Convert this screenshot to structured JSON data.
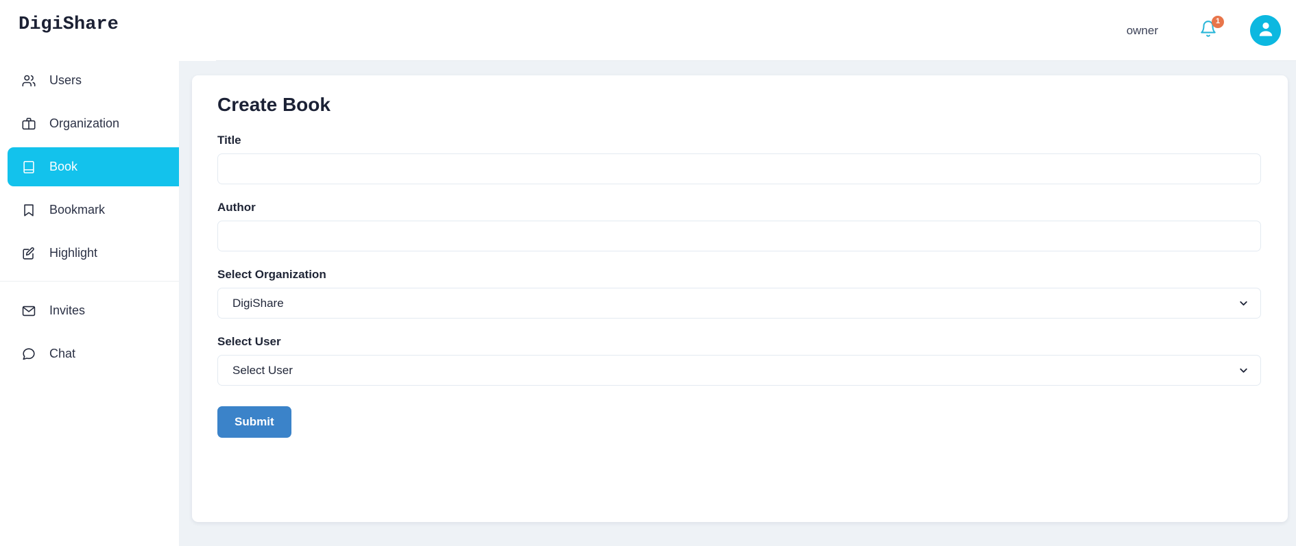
{
  "header": {
    "brand": "DigiShare",
    "user_label": "owner",
    "notification_count": "1",
    "bell_icon": "bell-icon",
    "avatar_icon": "user-avatar-icon"
  },
  "sidebar": {
    "items": [
      {
        "label": "Users",
        "icon": "users-icon",
        "active": false
      },
      {
        "label": "Organization",
        "icon": "briefcase-icon",
        "active": false
      },
      {
        "label": "Book",
        "icon": "book-icon",
        "active": true
      },
      {
        "label": "Bookmark",
        "icon": "bookmark-icon",
        "active": false
      },
      {
        "label": "Highlight",
        "icon": "edit-square-icon",
        "active": false
      },
      {
        "label": "Invites",
        "icon": "envelope-icon",
        "active": false
      },
      {
        "label": "Chat",
        "icon": "chat-bubble-icon",
        "active": false
      }
    ]
  },
  "main": {
    "card_title": "Create Book",
    "fields": {
      "title": {
        "label": "Title",
        "value": "",
        "placeholder": ""
      },
      "author": {
        "label": "Author",
        "value": "",
        "placeholder": ""
      },
      "organization": {
        "label": "Select Organization",
        "value": "DigiShare"
      },
      "user": {
        "label": "Select User",
        "value": "Select User"
      }
    },
    "submit_label": "Submit"
  },
  "colors": {
    "accent_cyan": "#13c2ec",
    "badge_orange": "#e8754a",
    "submit_blue": "#3b83c9",
    "content_bg": "#eef2f6",
    "text_dark": "#1b2135"
  }
}
